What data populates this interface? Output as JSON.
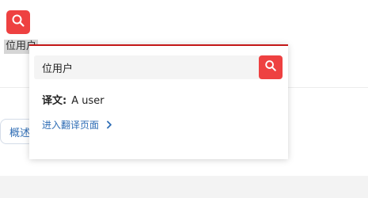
{
  "selection": {
    "text": "位用户"
  },
  "background": {
    "overview_tab_label": "概述"
  },
  "popup": {
    "search_value": "位用户",
    "translation_label": "译文:",
    "translation_value": "A user",
    "open_page_link": "进入翻译页面"
  },
  "colors": {
    "accent_red": "#ee4141",
    "popup_top_border": "#c41818",
    "link_blue": "#2f6db5"
  },
  "icons": {
    "trigger": "search-icon",
    "search_button": "search-icon",
    "link_arrow": "chevron-right-icon"
  }
}
